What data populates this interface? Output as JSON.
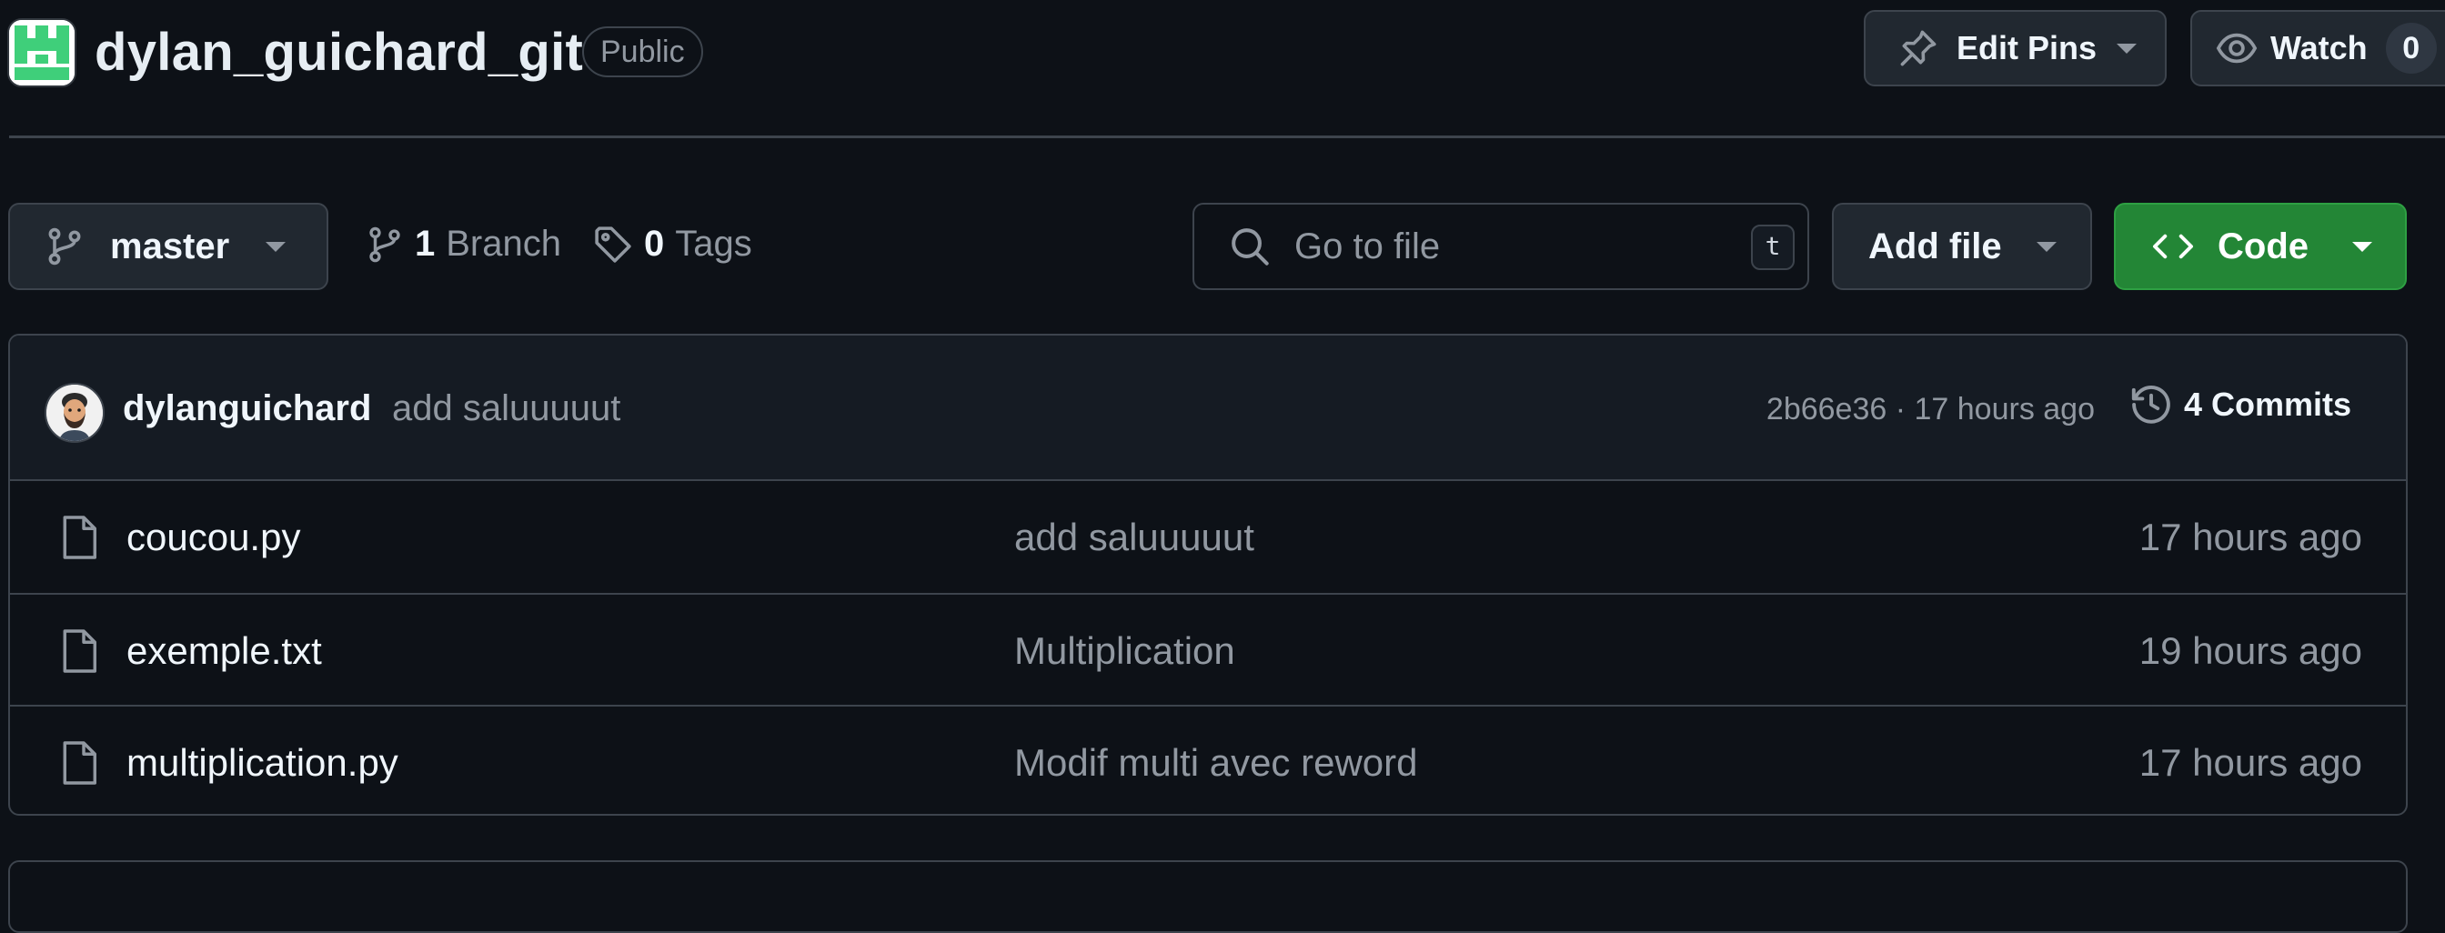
{
  "repo": {
    "name": "dylan_guichard_git",
    "visibility": "Public"
  },
  "header": {
    "edit_pins_label": "Edit Pins",
    "watch_label": "Watch",
    "watch_count": "0"
  },
  "toolbar": {
    "branch_name": "master",
    "branches_count": "1",
    "branches_label": "Branch",
    "tags_count": "0",
    "tags_label": "Tags",
    "search_placeholder": "Go to file",
    "search_shortcut": "t",
    "add_file_label": "Add file",
    "code_label": "Code"
  },
  "latest_commit": {
    "author": "dylanguichard",
    "message": "add saluuuuut",
    "hash_time": "2b66e36 · 17 hours ago",
    "commits_count_label": "4 Commits"
  },
  "files": [
    {
      "name": "coucou.py",
      "message": "add saluuuuut",
      "time": "17 hours ago"
    },
    {
      "name": "exemple.txt",
      "message": "Multiplication",
      "time": "19 hours ago"
    },
    {
      "name": "multiplication.py",
      "message": "Modif multi avec reword",
      "time": "17 hours ago"
    }
  ],
  "colors": {
    "background": "#0d1117",
    "border": "#3d444d",
    "code_button": "#238636",
    "muted_text": "#9198a1",
    "avatar_green": "#3fcf7a"
  },
  "icons": {
    "repo_avatar": "identicon",
    "edit_pins": "pin-icon",
    "watch": "eye-icon",
    "branch": "git-branch-icon",
    "tag": "tag-icon",
    "search": "search-icon",
    "code": "code-icon",
    "history": "history-icon",
    "file": "file-icon",
    "dropdown": "triangle-down-icon"
  }
}
